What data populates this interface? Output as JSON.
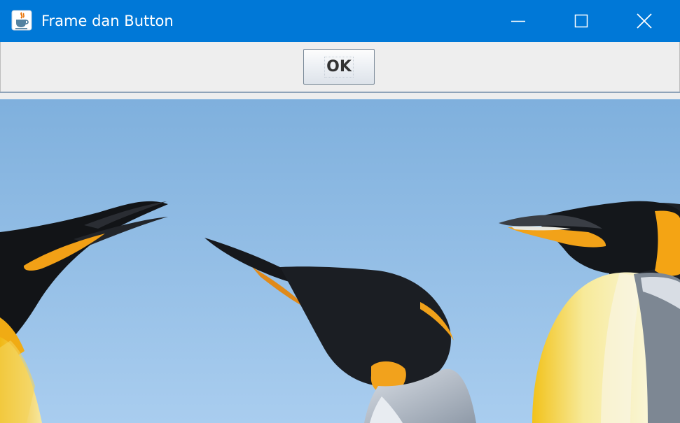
{
  "window": {
    "title": "Frame dan Button",
    "icon": "java-coffee-cup-icon",
    "controls": [
      "minimize-icon",
      "maximize-icon",
      "close-icon"
    ]
  },
  "toolbar": {
    "ok_label": "OK"
  },
  "image": {
    "subject": "king-penguins-photo"
  },
  "colors": {
    "titlebar": "#0078d7",
    "panel": "#eeeeee",
    "sky": "#8fbbe2"
  }
}
